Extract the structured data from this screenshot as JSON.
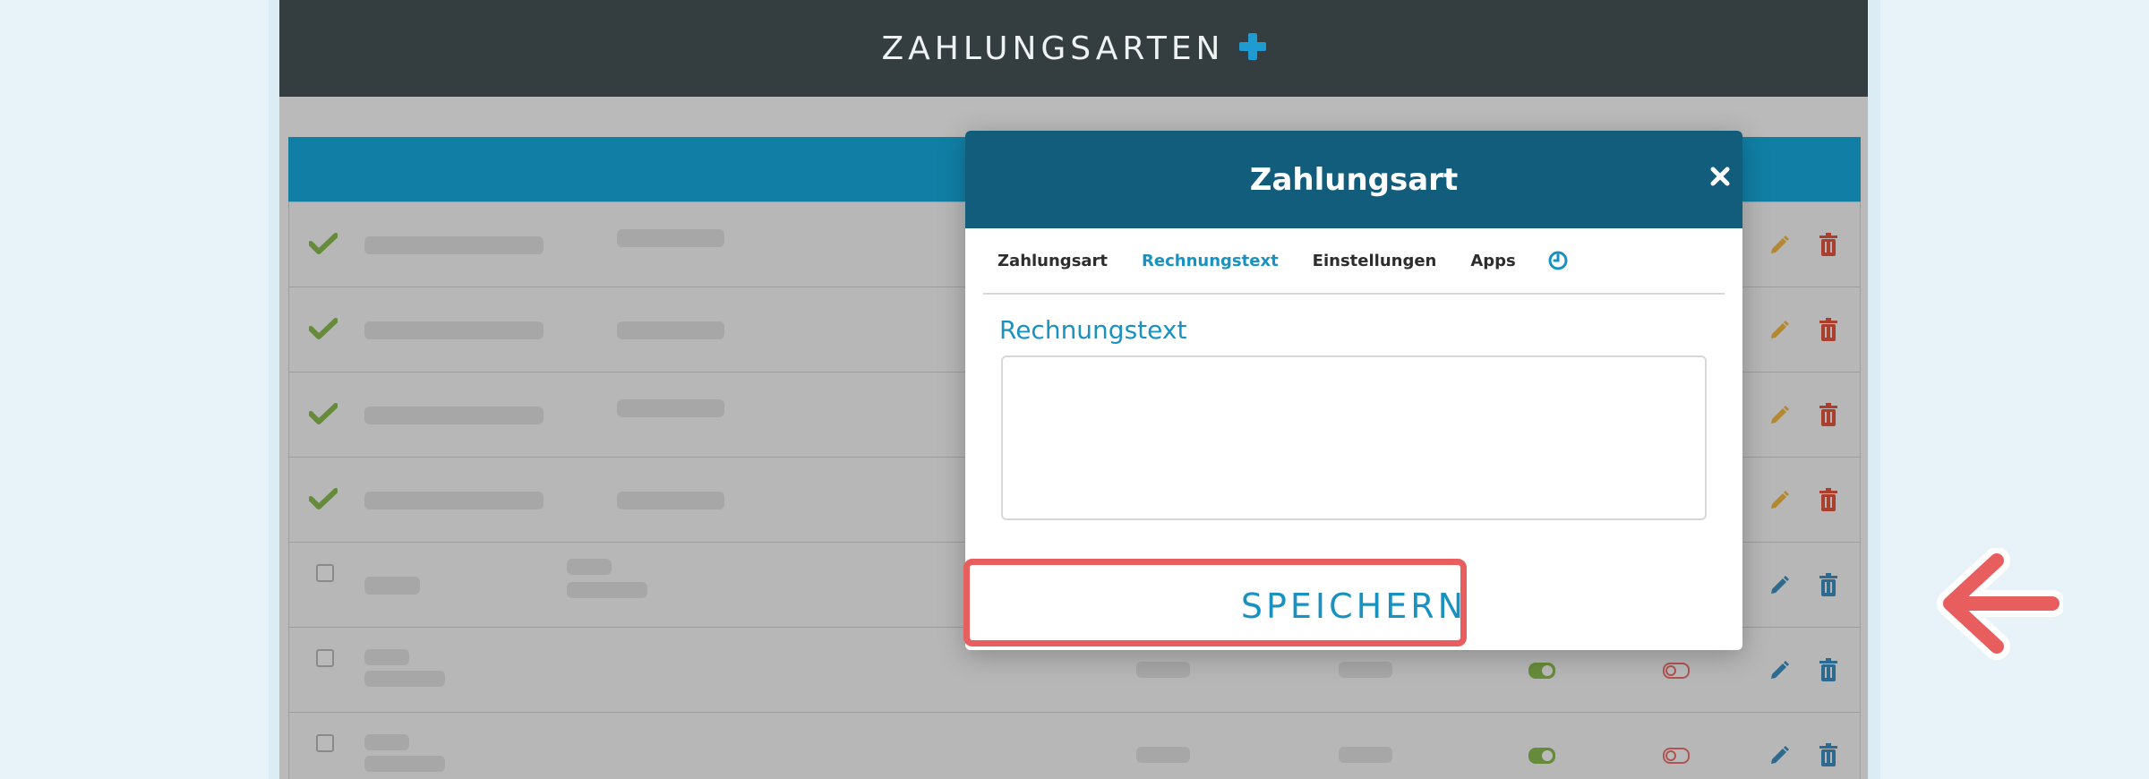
{
  "topbar": {
    "title": "ZAHLUNGSARTEN",
    "add_icon": "plus-icon"
  },
  "modal": {
    "title": "Zahlungsart",
    "close_icon": "close-icon",
    "tabs": [
      {
        "label": "Zahlungsart",
        "active": false
      },
      {
        "label": "Rechnungstext",
        "active": true
      },
      {
        "label": "Einstellungen",
        "active": false
      },
      {
        "label": "Apps",
        "active": false
      }
    ],
    "history_icon": "clock-icon",
    "section_label": "Rechnungstext",
    "textarea_value": "",
    "save_label": "SPEICHERN"
  },
  "table": {
    "row_count": 7,
    "active_rows": 4,
    "row_actions": [
      "pencil-icon",
      "trash-icon"
    ],
    "status_icons": [
      "check-icon",
      "checkbox"
    ]
  },
  "colors": {
    "topbar": "#343d40",
    "accent": "#1992c2",
    "modal_header": "#125d7c",
    "table_header": "#18aee3",
    "highlight": "#e85d5d",
    "check": "#8cc152",
    "edit_yellow": "#f6bb42",
    "delete_red": "#e9573f"
  }
}
